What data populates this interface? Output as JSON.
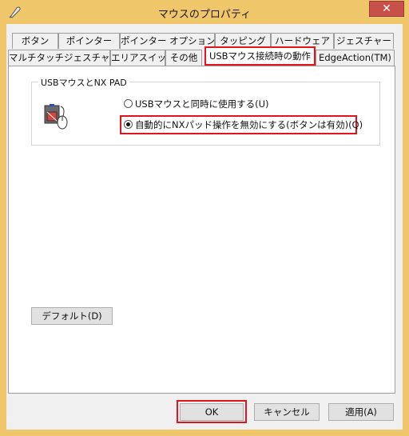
{
  "window": {
    "title": "マウスのプロパティ",
    "close_glyph": "✕"
  },
  "tabs": {
    "row1": [
      "ボタン",
      "ポインター",
      "ポインター オプション",
      "タッピング",
      "ハードウェア",
      "ジェスチャー"
    ],
    "row2": [
      "マルチタッチジェスチャー",
      "エリアスイッチ",
      "その他",
      "USBマウス接続時の動作",
      "EdgeAction(TM)"
    ]
  },
  "group": {
    "title": "USBマウスとNX PAD",
    "option1": "USBマウスと同時に使用する(U)",
    "option2": "自動的にNXパッド操作を無効にする(ボタンは有効)(Q)",
    "selected_option": 2
  },
  "buttons": {
    "default": "デフォルト(D)",
    "ok": "OK",
    "cancel": "キャンセル",
    "apply": "適用(A)"
  },
  "colors": {
    "titlebar": "#f0c66b",
    "highlight": "#e3141b",
    "close": "#c7504b"
  },
  "icons": {
    "app": "mouse-icon",
    "pad": "touchpad-mouse-icon",
    "close": "close-icon"
  }
}
